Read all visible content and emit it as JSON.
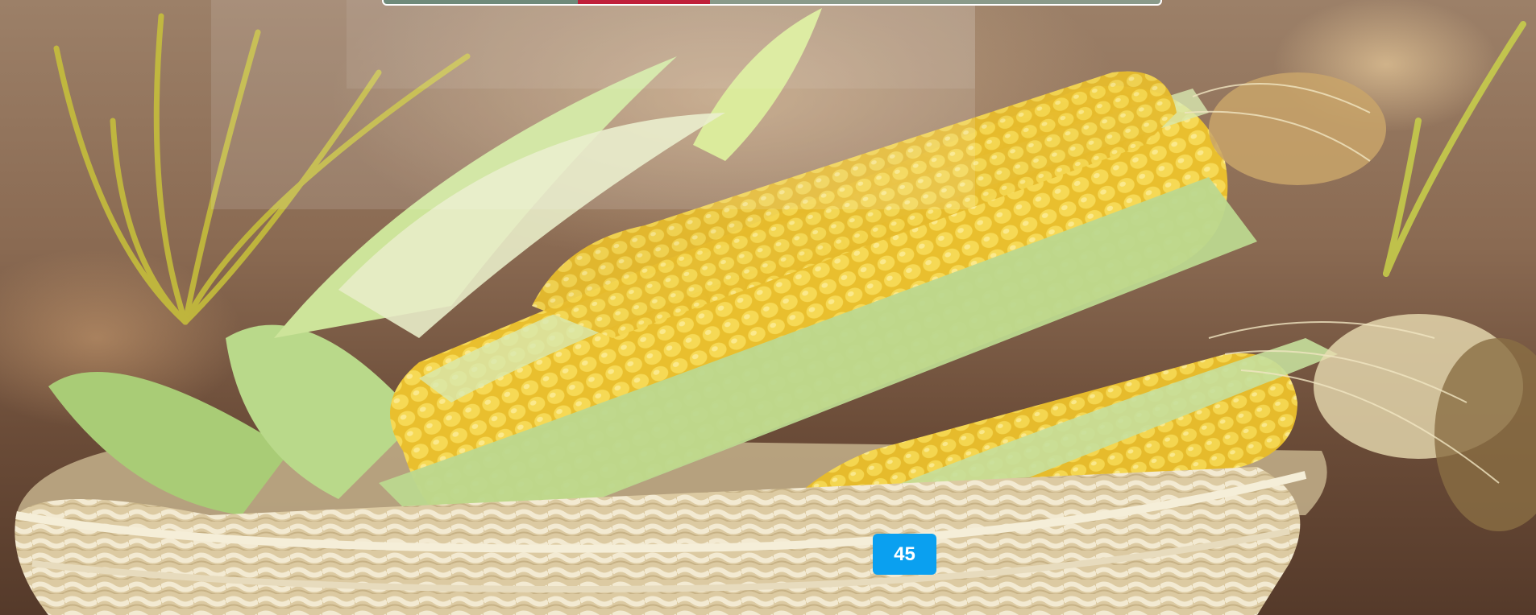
{
  "hero": {
    "image_subject": "corn-basket-photo"
  },
  "pagination": {
    "current_page": "45"
  },
  "colors": {
    "badge": "#0aa0f0",
    "corn_kernel": "#f4d34a",
    "husk": "#b9d98a",
    "basket": "#e9dcc0"
  }
}
